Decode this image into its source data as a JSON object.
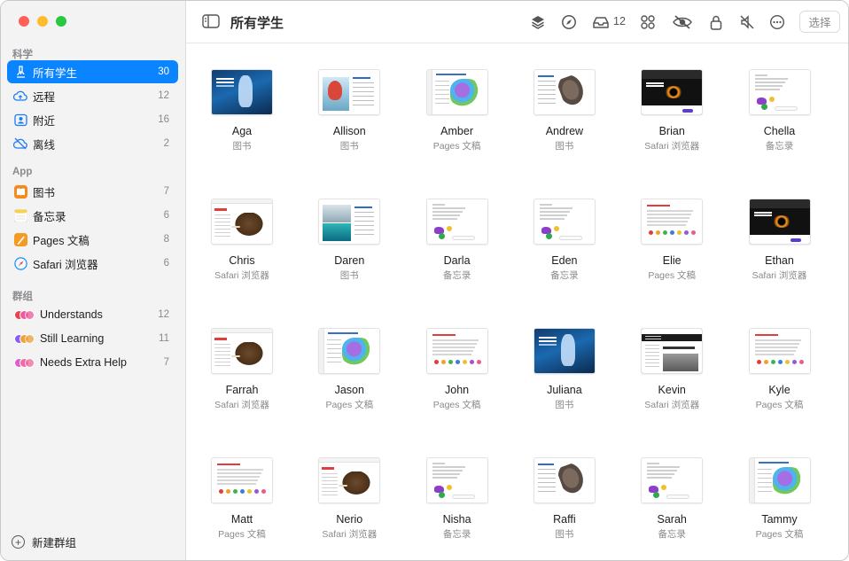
{
  "sidebar": {
    "sections": {
      "science": "科学",
      "app": "App",
      "groups": "群组"
    },
    "class_items": [
      {
        "label": "所有学生",
        "count": "30",
        "icon": "microscope-icon",
        "active": true
      },
      {
        "label": "远程",
        "count": "12",
        "icon": "cloud-icon"
      },
      {
        "label": "附近",
        "count": "16",
        "icon": "person-square-icon"
      },
      {
        "label": "离线",
        "count": "2",
        "icon": "cloud-offline-icon"
      }
    ],
    "app_items": [
      {
        "label": "图书",
        "count": "7",
        "icon": "books-app-icon",
        "color": "#f58a1f"
      },
      {
        "label": "备忘录",
        "count": "6",
        "icon": "notes-app-icon",
        "color": "#f7d24a"
      },
      {
        "label": "Pages 文稿",
        "count": "8",
        "icon": "pages-app-icon",
        "color": "#f59a23"
      },
      {
        "label": "Safari 浏览器",
        "count": "6",
        "icon": "safari-app-icon",
        "color": "#1c8ef9"
      }
    ],
    "group_items": [
      {
        "label": "Understands",
        "count": "12",
        "icon": "group-avatars-icon",
        "colors": [
          "#e8424a",
          "#ee5b9c"
        ]
      },
      {
        "label": "Still Learning",
        "count": "11",
        "icon": "group-avatars-icon",
        "colors": [
          "#8a5cf6",
          "#f0a23a"
        ]
      },
      {
        "label": "Needs Extra Help",
        "count": "7",
        "icon": "group-avatars-icon",
        "colors": [
          "#e05bd0",
          "#f06aa0"
        ]
      }
    ],
    "new_group": "新建群组"
  },
  "toolbar": {
    "title": "所有学生",
    "inbox_count": "12",
    "select_label": "选择",
    "icons": [
      "layers-icon",
      "compass-icon",
      "inbox-icon",
      "apps-grid-icon",
      "eye-slash-icon",
      "lock-icon",
      "mute-icon",
      "more-icon"
    ]
  },
  "students": [
    {
      "name": "Aga",
      "app": "图书",
      "thumb": "book"
    },
    {
      "name": "Allison",
      "app": "图书",
      "thumb": "bird"
    },
    {
      "name": "Amber",
      "app": "Pages 文稿",
      "thumb": "map"
    },
    {
      "name": "Andrew",
      "app": "图书",
      "thumb": "bone"
    },
    {
      "name": "Brian",
      "app": "Safari 浏览器",
      "thumb": "space"
    },
    {
      "name": "Chella",
      "app": "备忘录",
      "thumb": "notes"
    },
    {
      "name": "Chris",
      "app": "Safari 浏览器",
      "thumb": "mam"
    },
    {
      "name": "Daren",
      "app": "图书",
      "thumb": "ocean"
    },
    {
      "name": "Darla",
      "app": "备忘录",
      "thumb": "notes"
    },
    {
      "name": "Eden",
      "app": "备忘录",
      "thumb": "notes"
    },
    {
      "name": "Elie",
      "app": "Pages 文稿",
      "thumb": "pages"
    },
    {
      "name": "Ethan",
      "app": "Safari 浏览器",
      "thumb": "space"
    },
    {
      "name": "Farrah",
      "app": "Safari 浏览器",
      "thumb": "mam"
    },
    {
      "name": "Jason",
      "app": "Pages 文稿",
      "thumb": "map"
    },
    {
      "name": "John",
      "app": "Pages 文稿",
      "thumb": "pages"
    },
    {
      "name": "Juliana",
      "app": "图书",
      "thumb": "book"
    },
    {
      "name": "Kevin",
      "app": "Safari 浏览器",
      "thumb": "old"
    },
    {
      "name": "Kyle",
      "app": "Pages 文稿",
      "thumb": "pages"
    },
    {
      "name": "Matt",
      "app": "Pages 文稿",
      "thumb": "pages"
    },
    {
      "name": "Nerio",
      "app": "Safari 浏览器",
      "thumb": "mam"
    },
    {
      "name": "Nisha",
      "app": "备忘录",
      "thumb": "notes"
    },
    {
      "name": "Raffi",
      "app": "图书",
      "thumb": "bone"
    },
    {
      "name": "Sarah",
      "app": "备忘录",
      "thumb": "notes"
    },
    {
      "name": "Tammy",
      "app": "Pages 文稿",
      "thumb": "map"
    }
  ],
  "colors": {
    "accent": "#0a84ff",
    "sidebar_bg": "#f3f3f3",
    "secondary_text": "#8a8a8e"
  }
}
